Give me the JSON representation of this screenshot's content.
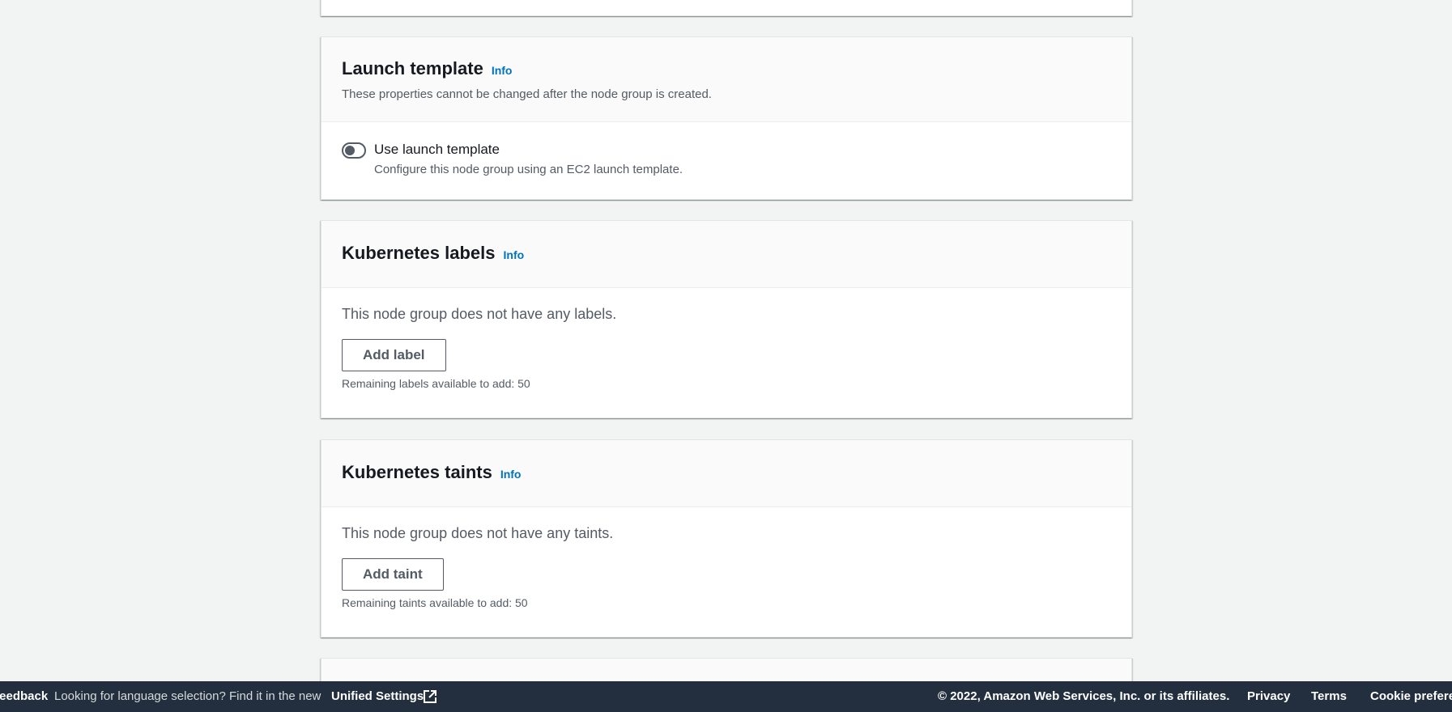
{
  "launch_template": {
    "title": "Launch template",
    "info": "Info",
    "description": "These properties cannot be changed after the node group is created.",
    "toggle": {
      "label": "Use launch template",
      "description": "Configure this node group using an EC2 launch template.",
      "checked": false
    }
  },
  "kubernetes_labels": {
    "title": "Kubernetes labels",
    "info": "Info",
    "empty_text": "This node group does not have any labels.",
    "button": "Add label",
    "remaining": "Remaining labels available to add: 50"
  },
  "kubernetes_taints": {
    "title": "Kubernetes taints",
    "info": "Info",
    "empty_text": "This node group does not have any taints.",
    "button": "Add taint",
    "remaining": "Remaining taints available to add: 50"
  },
  "footer": {
    "feedback": "Feedback",
    "language_prompt": "Looking for language selection? Find it in the new",
    "unified_settings": "Unified Settings",
    "external_icon": "external-link-icon",
    "copyright": "© 2022, Amazon Web Services, Inc. or its affiliates.",
    "privacy": "Privacy",
    "terms": "Terms",
    "cookie": "Cookie preferences"
  },
  "colors": {
    "page_bg": "#f2f3f3",
    "info_link": "#0073bb",
    "footer_bg": "#232f3e",
    "secondary_text": "#545b64"
  }
}
